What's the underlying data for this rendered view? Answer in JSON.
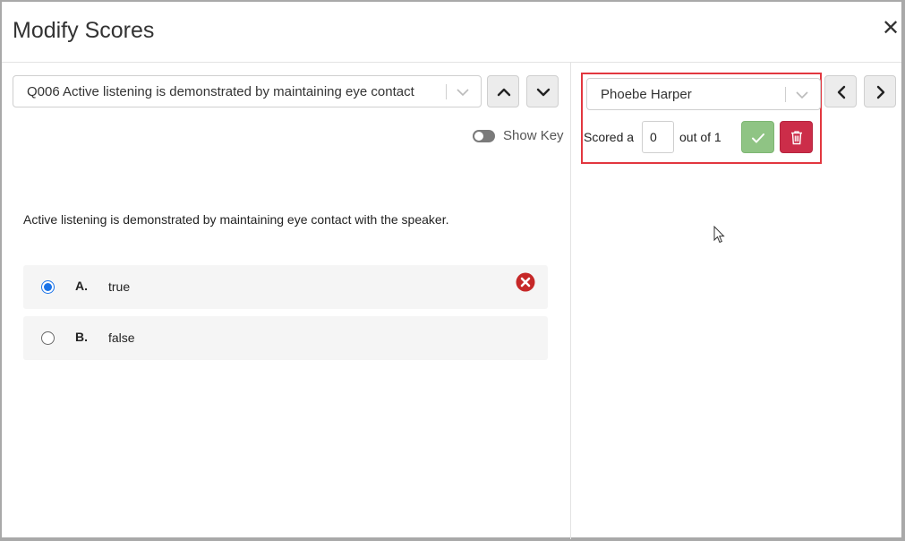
{
  "modal": {
    "title": "Modify Scores",
    "close_label": "✕"
  },
  "question_nav": {
    "selected_question": "Q006 Active listening is demonstrated by maintaining eye contact",
    "up_icon": "chevron-up-icon",
    "down_icon": "chevron-down-icon"
  },
  "show_key": {
    "label": "Show Key",
    "enabled": false
  },
  "question": {
    "text": "Active listening is demonstrated by maintaining eye contact with the speaker.",
    "options": [
      {
        "letter": "A.",
        "text": "true",
        "selected": true,
        "marked_wrong": true
      },
      {
        "letter": "B.",
        "text": "false",
        "selected": false,
        "marked_wrong": false
      }
    ]
  },
  "student_nav": {
    "selected_student": "Phoebe Harper",
    "prev_icon": "chevron-left-icon",
    "next_icon": "chevron-right-icon"
  },
  "scoring": {
    "scored_label": "Scored a",
    "score_value": "0",
    "out_of_label": "out of 1",
    "save_icon": "check-icon",
    "delete_icon": "trash-icon"
  },
  "colors": {
    "highlight_border": "#e2373f",
    "save_green": "#8fc484",
    "delete_red": "#cc2d49",
    "radio_blue": "#1a73e8",
    "wrong_red": "#c62828"
  }
}
